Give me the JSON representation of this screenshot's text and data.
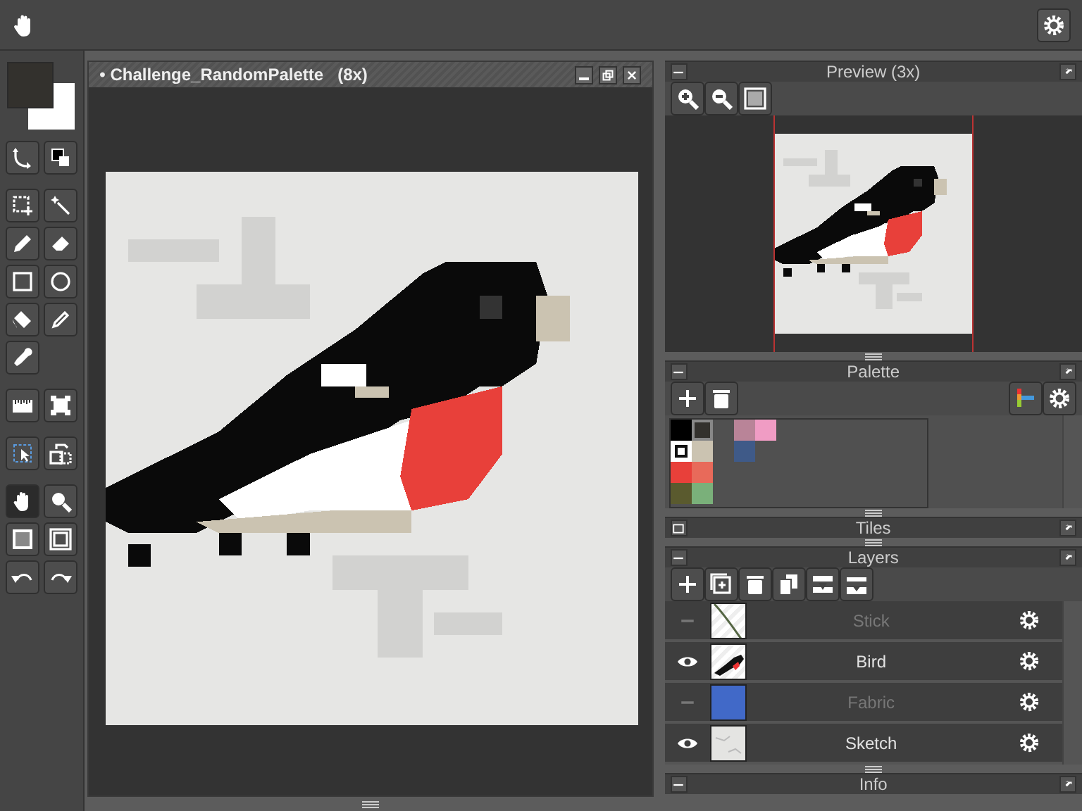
{
  "color_swatches": [
    {
      "kind": "primary",
      "color": "#33312d"
    },
    {
      "kind": "secondary",
      "color": "#ffffff"
    }
  ],
  "tool_groups": [
    [
      {
        "kind": "curve",
        "selected": false
      },
      {
        "kind": "swap",
        "selected": false
      }
    ],
    [
      {
        "kind": "select",
        "selected": false
      },
      {
        "kind": "wand",
        "selected": false
      },
      {
        "kind": "pencil",
        "selected": false
      },
      {
        "kind": "eraser",
        "selected": false
      },
      {
        "kind": "rect",
        "selected": false
      },
      {
        "kind": "ellipse",
        "selected": false
      },
      {
        "kind": "fill",
        "selected": false
      },
      {
        "kind": "pen",
        "selected": false
      },
      {
        "kind": "picker",
        "selected": false
      }
    ],
    [
      {
        "kind": "ruler",
        "selected": false
      },
      {
        "kind": "transform",
        "selected": false
      }
    ],
    [
      {
        "kind": "layerselect",
        "selected": false
      },
      {
        "kind": "moveselect",
        "selected": false
      }
    ],
    [
      {
        "kind": "hand",
        "selected": true
      },
      {
        "kind": "zoom",
        "selected": false
      },
      {
        "kind": "frame",
        "selected": false
      },
      {
        "kind": "frame2",
        "selected": false
      },
      {
        "kind": "undo",
        "selected": false
      },
      {
        "kind": "redo",
        "selected": false
      }
    ]
  ],
  "document": {
    "modified_mark": "•",
    "title": "Challenge_RandomPalette",
    "zoom": "(8x)"
  },
  "panels": [
    {
      "kind": "preview",
      "title": "Preview (3x)",
      "expanded": true
    },
    {
      "kind": "palette",
      "title": "Palette",
      "expanded": true,
      "rows": [
        [
          {
            "color": "#000000",
            "selected": false,
            "marked": false
          },
          {
            "color": "#33312d",
            "selected": true,
            "marked": false
          },
          null,
          {
            "color": "#b98498",
            "selected": false,
            "marked": false
          },
          {
            "color": "#f09cc4",
            "selected": false,
            "marked": false
          }
        ],
        [
          {
            "color": "#ffffff",
            "selected": false,
            "marked": true
          },
          {
            "color": "#cbc3b1",
            "selected": false,
            "marked": false
          },
          null,
          {
            "color": "#3f5a88",
            "selected": false,
            "marked": false
          }
        ],
        [
          {
            "color": "#e8403a",
            "selected": false,
            "marked": false
          },
          {
            "color": "#e86a5a",
            "selected": false,
            "marked": false
          }
        ],
        [
          {
            "color": "#5a5a2e",
            "selected": false,
            "marked": false
          },
          {
            "color": "#7ab07a",
            "selected": false,
            "marked": false
          }
        ]
      ]
    },
    {
      "title": "Tiles",
      "expanded": false
    },
    {
      "kind": "layers",
      "title": "Layers",
      "expanded": true,
      "layers": [
        {
          "name": "Stick",
          "visible": false,
          "kind": "stick"
        },
        {
          "name": "Bird",
          "visible": true,
          "kind": "bird"
        },
        {
          "name": "Fabric",
          "visible": false,
          "kind": "fill"
        },
        {
          "name": "Sketch",
          "visible": true,
          "kind": "sketch"
        }
      ]
    },
    {
      "title": "Info",
      "expanded": true
    }
  ]
}
